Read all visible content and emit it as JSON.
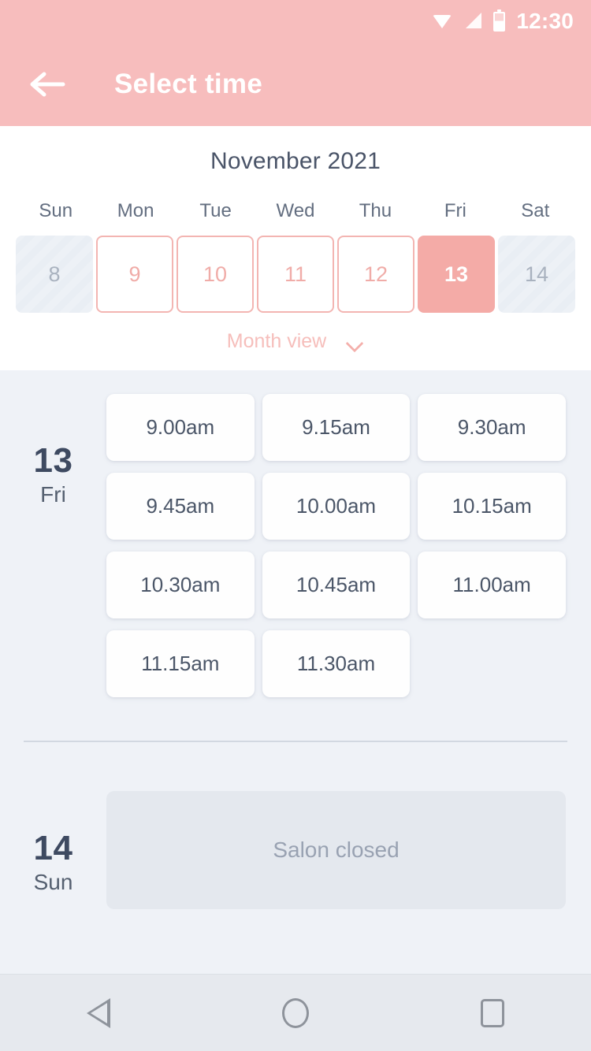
{
  "status_bar": {
    "time": "12:30",
    "icons": [
      "wifi-icon",
      "signal-icon",
      "battery-icon"
    ]
  },
  "app_bar": {
    "back_icon": "back-arrow-icon",
    "title": "Select time"
  },
  "calendar": {
    "month_title": "November 2021",
    "weekdays": [
      "Sun",
      "Mon",
      "Tue",
      "Wed",
      "Thu",
      "Fri",
      "Sat"
    ],
    "days": [
      {
        "number": "8",
        "state": "disabled"
      },
      {
        "number": "9",
        "state": "available"
      },
      {
        "number": "10",
        "state": "available"
      },
      {
        "number": "11",
        "state": "available"
      },
      {
        "number": "12",
        "state": "available"
      },
      {
        "number": "13",
        "state": "selected"
      },
      {
        "number": "14",
        "state": "disabled"
      }
    ],
    "month_view_label": "Month view",
    "month_view_icon": "chevron-down-icon"
  },
  "schedule": [
    {
      "day_number": "13",
      "day_of_week": "Fri",
      "slots": [
        "9.00am",
        "9.15am",
        "9.30am",
        "9.45am",
        "10.00am",
        "10.15am",
        "10.30am",
        "10.45am",
        "11.00am",
        "11.15am",
        "11.30am"
      ]
    },
    {
      "day_number": "14",
      "day_of_week": "Sun",
      "closed_message": "Salon closed"
    }
  ],
  "nav_bar": {
    "back_icon": "nav-back-triangle-icon",
    "home_icon": "nav-home-circle-icon",
    "recents_icon": "nav-recents-square-icon"
  },
  "colors": {
    "header_pink": "#F7BDBD",
    "accent_pink": "#F4ABA7",
    "body_bg": "#EFF2F7",
    "text_dark": "#3E4A61",
    "closed_bg": "#E4E8EE"
  }
}
